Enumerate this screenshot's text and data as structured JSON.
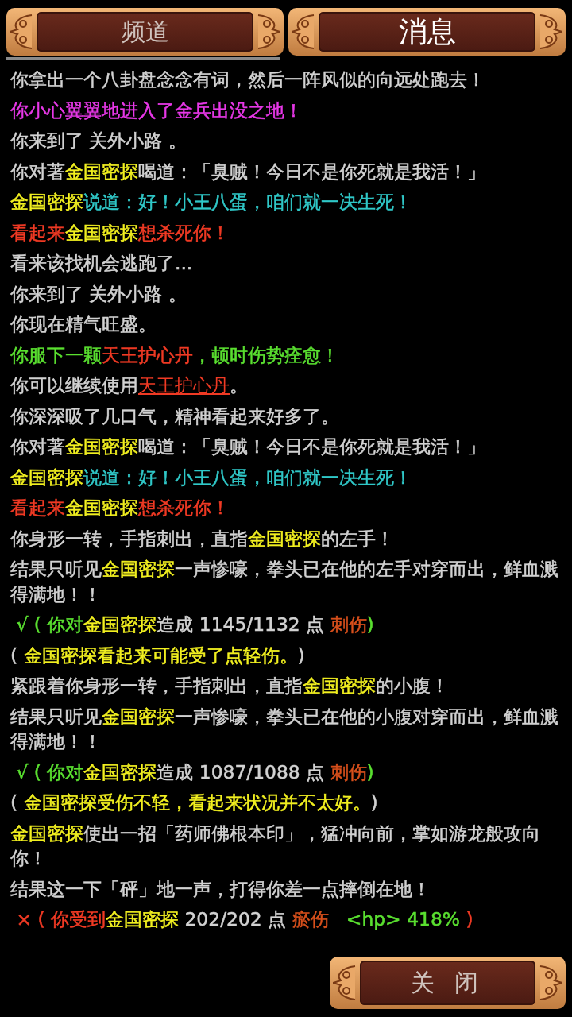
{
  "tabs": [
    {
      "label": "频道",
      "selected": false
    },
    {
      "label": "消息",
      "selected": true
    }
  ],
  "log": [
    {
      "segments": [
        {
          "text": "你拿出一个八卦盘念念有词，然后一阵风似的向远处跑去！",
          "color": "#d2d2d2"
        }
      ]
    },
    {
      "segments": [
        {
          "text": "你小心翼翼地进入了金兵出没之地！",
          "color": "#e838e8"
        }
      ]
    },
    {
      "segments": [
        {
          "text": "你来到了 关外小路 。",
          "color": "#d2d2d2"
        }
      ]
    },
    {
      "segments": [
        {
          "text": "你对著",
          "color": "#d2d2d2"
        },
        {
          "text": "金国密探",
          "color": "#f2f020"
        },
        {
          "text": "喝道：「臭贼！今日不是你死就是我活！」",
          "color": "#d2d2d2"
        }
      ]
    },
    {
      "segments": [
        {
          "text": "金国密探",
          "color": "#f2f020"
        },
        {
          "text": "说道：好！小王八蛋，咱们就一决生死！",
          "color": "#30c8c8"
        }
      ]
    },
    {
      "segments": [
        {
          "text": "看起来",
          "color": "#f03a24"
        },
        {
          "text": "金国密探",
          "color": "#f2f020"
        },
        {
          "text": "想杀死你！",
          "color": "#f03a24"
        }
      ]
    },
    {
      "segments": [
        {
          "text": "看来该找机会逃跑了...",
          "color": "#d2d2d2"
        }
      ]
    },
    {
      "segments": [
        {
          "text": "你来到了 关外小路 。",
          "color": "#d2d2d2"
        }
      ]
    },
    {
      "segments": [
        {
          "text": "你现在精气旺盛。",
          "color": "#d2d2d2"
        }
      ]
    },
    {
      "segments": [
        {
          "text": "你服下一颗",
          "color": "#5ae030"
        },
        {
          "text": "天王护心丹",
          "color": "#f03a24"
        },
        {
          "text": "，顿时伤势痊愈！",
          "color": "#5ae030"
        }
      ]
    },
    {
      "segments": [
        {
          "text": "你可以继续使用",
          "color": "#d2d2d2"
        },
        {
          "text": "天王护心丹",
          "color": "#f03a24",
          "kind": "link"
        },
        {
          "text": "。",
          "color": "#d2d2d2"
        }
      ]
    },
    {
      "segments": [
        {
          "text": "你深深吸了几口气，精神看起来好多了。",
          "color": "#d2d2d2"
        }
      ]
    },
    {
      "segments": [
        {
          "text": "你对著",
          "color": "#d2d2d2"
        },
        {
          "text": "金国密探",
          "color": "#f2f020"
        },
        {
          "text": "喝道：「臭贼！今日不是你死就是我活！」",
          "color": "#d2d2d2"
        }
      ]
    },
    {
      "segments": [
        {
          "text": "金国密探",
          "color": "#f2f020"
        },
        {
          "text": "说道：好！小王八蛋，咱们就一决生死！",
          "color": "#30c8c8"
        }
      ]
    },
    {
      "segments": [
        {
          "text": "看起来",
          "color": "#f03a24"
        },
        {
          "text": "金国密探",
          "color": "#f2f020"
        },
        {
          "text": "想杀死你！",
          "color": "#f03a24"
        }
      ]
    },
    {
      "segments": [
        {
          "text": "你身形一转，手指刺出，直指",
          "color": "#d2d2d2"
        },
        {
          "text": "金国密探",
          "color": "#f2f020"
        },
        {
          "text": "的左手！",
          "color": "#d2d2d2"
        }
      ]
    },
    {
      "segments": [
        {
          "text": "结果只听见",
          "color": "#d2d2d2"
        },
        {
          "text": "金国密探",
          "color": "#f2f020"
        },
        {
          "text": "一声惨嚎，拳头已在他的左手对穿而出，鲜血溅得满地！！",
          "color": "#d2d2d2"
        }
      ]
    },
    {
      "segments": [
        {
          "text": " √ ( ",
          "color": "#5ae030"
        },
        {
          "text": "你对",
          "color": "#5ae030"
        },
        {
          "text": "金国密探",
          "color": "#f2f020"
        },
        {
          "text": "造成 1145/1132 点 ",
          "color": "#d2d2d2"
        },
        {
          "text": "刺伤",
          "color": "#d8501c"
        },
        {
          "text": ")",
          "color": "#5ae030"
        }
      ]
    },
    {
      "segments": [
        {
          "text": "( ",
          "color": "#d2d2d2"
        },
        {
          "text": "金国密探看起来可能受了点轻伤。",
          "color": "#f2f020"
        },
        {
          "text": ")",
          "color": "#d2d2d2"
        }
      ]
    },
    {
      "segments": [
        {
          "text": "紧跟着你身形一转，手指刺出，直指",
          "color": "#d2d2d2"
        },
        {
          "text": "金国密探",
          "color": "#f2f020"
        },
        {
          "text": "的小腹！",
          "color": "#d2d2d2"
        }
      ]
    },
    {
      "segments": [
        {
          "text": "结果只听见",
          "color": "#d2d2d2"
        },
        {
          "text": "金国密探",
          "color": "#f2f020"
        },
        {
          "text": "一声惨嚎，拳头已在他的小腹对穿而出，鲜血溅得满地！！",
          "color": "#d2d2d2"
        }
      ]
    },
    {
      "segments": [
        {
          "text": " √ ( ",
          "color": "#5ae030"
        },
        {
          "text": "你对",
          "color": "#5ae030"
        },
        {
          "text": "金国密探",
          "color": "#f2f020"
        },
        {
          "text": "造成 1087/1088 点 ",
          "color": "#d2d2d2"
        },
        {
          "text": "刺伤",
          "color": "#d8501c"
        },
        {
          "text": ")",
          "color": "#5ae030"
        }
      ]
    },
    {
      "segments": [
        {
          "text": "( ",
          "color": "#d2d2d2"
        },
        {
          "text": "金国密探受伤不轻，看起来状况并不太好。",
          "color": "#f2f020"
        },
        {
          "text": ")",
          "color": "#d2d2d2"
        }
      ]
    },
    {
      "segments": [
        {
          "text": "金国密探",
          "color": "#f2f020"
        },
        {
          "text": "使出一招「药师佛根本印」，猛冲向前，掌如游龙般攻向你！",
          "color": "#d2d2d2"
        }
      ]
    },
    {
      "segments": [
        {
          "text": "结果这一下「砰」地一声，打得你差一点摔倒在地！",
          "color": "#d2d2d2"
        }
      ]
    },
    {
      "segments": [
        {
          "text": " × ( 你受到",
          "color": "#f03a24"
        },
        {
          "text": "金国密探",
          "color": "#f2f020"
        },
        {
          "text": " 202/202 点 ",
          "color": "#d2d2d2"
        },
        {
          "text": "瘀伤",
          "color": "#d8501c"
        },
        {
          "text": "   <hp> 418% ",
          "color": "#5ae030"
        },
        {
          "text": ")",
          "color": "#f03a24"
        }
      ]
    }
  ],
  "close_button": {
    "label": "关 闭"
  }
}
